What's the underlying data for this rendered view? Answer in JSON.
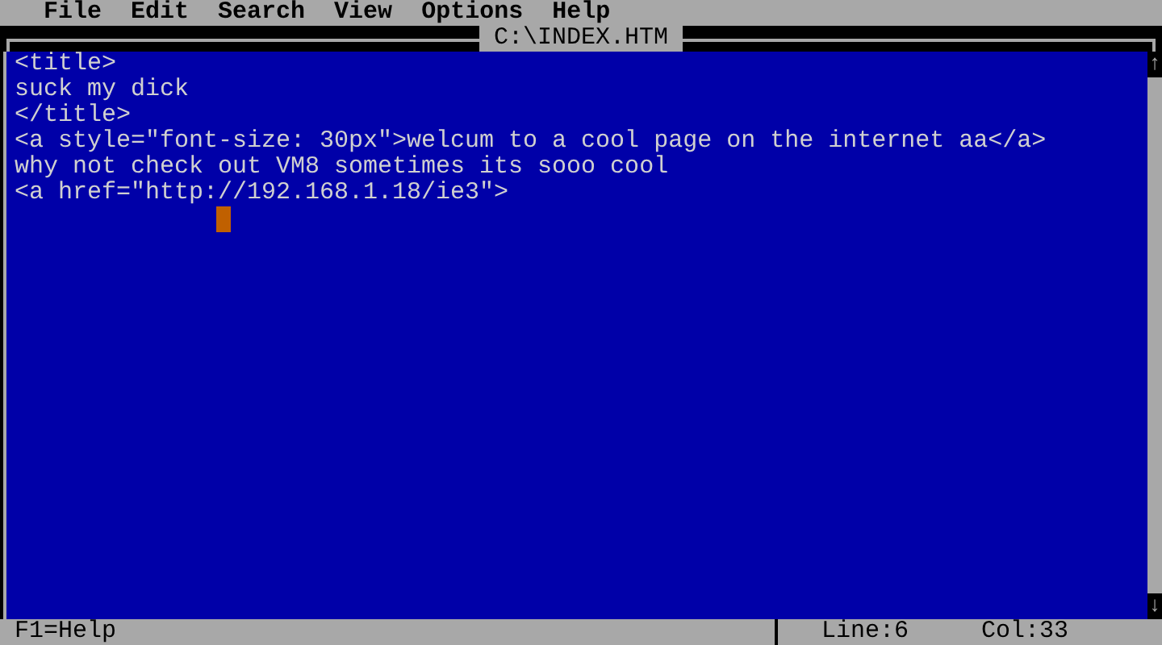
{
  "menu": [
    {
      "label": "File"
    },
    {
      "label": "Edit"
    },
    {
      "label": "Search"
    },
    {
      "label": "View"
    },
    {
      "label": "Options"
    },
    {
      "label": "Help"
    }
  ],
  "window": {
    "title": "C:\\INDEX.HTM"
  },
  "editor": {
    "lines": [
      "<title>",
      "suck my dick",
      "</title>",
      "<a style=\"font-size: 30px\">welcum to a cool page on the internet aa</a>",
      "why not check out VM8 sometimes its sooo cool",
      "<a href=\"http://192.168.1.18/ie3\">"
    ]
  },
  "scrollbar": {
    "up": "↑",
    "down": "↓"
  },
  "status_bar": {
    "help": "F1=Help",
    "line": "Line:6",
    "col": "Col:33"
  }
}
